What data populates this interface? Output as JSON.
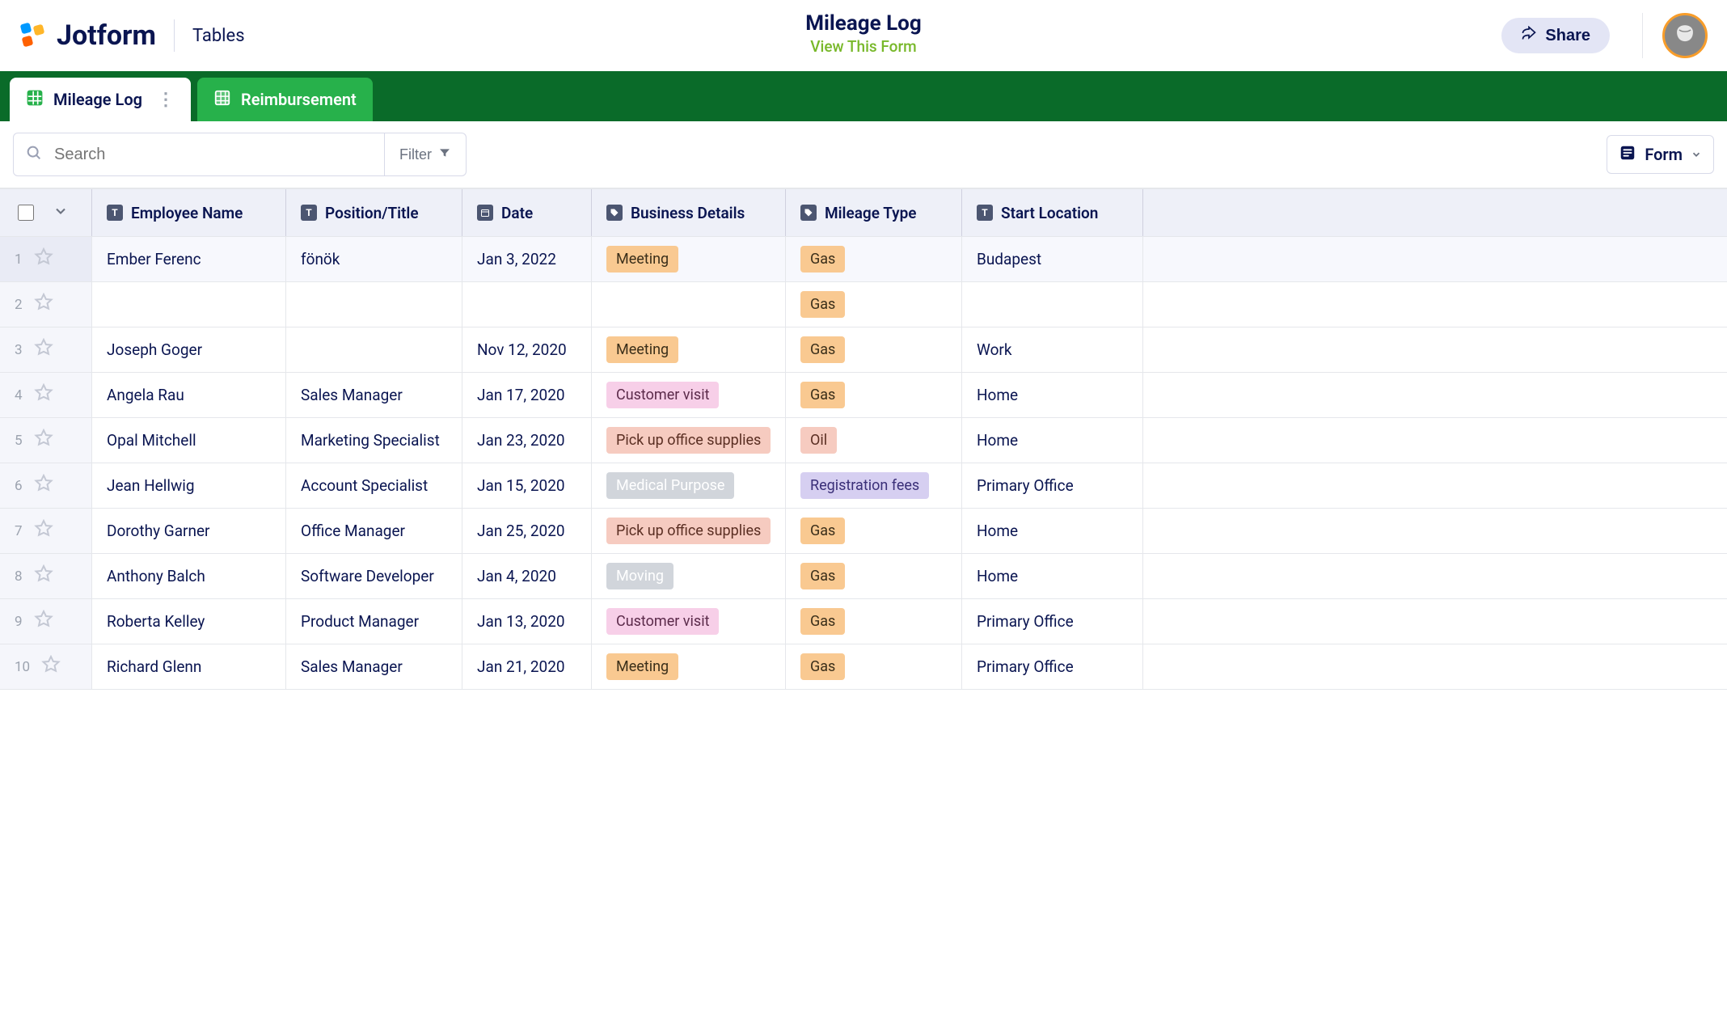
{
  "header": {
    "brand": "Jotform",
    "section": "Tables",
    "title": "Mileage Log",
    "subtitle": "View This Form",
    "share_label": "Share"
  },
  "tabs": [
    {
      "label": "Mileage Log",
      "active": true
    },
    {
      "label": "Reimbursement",
      "active": false
    }
  ],
  "toolbar": {
    "search_placeholder": "Search",
    "filter_label": "Filter",
    "view_label": "Form"
  },
  "columns": {
    "employee": "Employee Name",
    "position": "Position/Title",
    "date": "Date",
    "business": "Business Details",
    "mileage": "Mileage Type",
    "start": "Start Location"
  },
  "tag_colors": {
    "Meeting": "orange",
    "Customer visit": "pink",
    "Pick up office supplies": "peach",
    "Medical Purpose": "grey",
    "Moving": "grey",
    "Gas": "orange",
    "Oil": "peach",
    "Registration fees": "purple"
  },
  "rows": [
    {
      "n": 1,
      "employee": "Ember Ferenc",
      "position": "fönök",
      "date": "Jan 3, 2022",
      "business": "Meeting",
      "mileage": "Gas",
      "start": "Budapest"
    },
    {
      "n": 2,
      "employee": "",
      "position": "",
      "date": "",
      "business": "",
      "mileage": "Gas",
      "start": ""
    },
    {
      "n": 3,
      "employee": "Joseph Goger",
      "position": "",
      "date": "Nov 12, 2020",
      "business": "Meeting",
      "mileage": "Gas",
      "start": "Work"
    },
    {
      "n": 4,
      "employee": "Angela Rau",
      "position": "Sales Manager",
      "date": "Jan 17, 2020",
      "business": "Customer visit",
      "mileage": "Gas",
      "start": "Home"
    },
    {
      "n": 5,
      "employee": "Opal Mitchell",
      "position": "Marketing Specialist",
      "date": "Jan 23, 2020",
      "business": "Pick up office supplies",
      "mileage": "Oil",
      "start": "Home"
    },
    {
      "n": 6,
      "employee": "Jean Hellwig",
      "position": "Account Specialist",
      "date": "Jan 15, 2020",
      "business": "Medical Purpose",
      "mileage": "Registration fees",
      "start": "Primary Office"
    },
    {
      "n": 7,
      "employee": "Dorothy Garner",
      "position": "Office Manager",
      "date": "Jan 25, 2020",
      "business": "Pick up office supplies",
      "mileage": "Gas",
      "start": "Home"
    },
    {
      "n": 8,
      "employee": "Anthony Balch",
      "position": "Software Developer",
      "date": "Jan 4, 2020",
      "business": "Moving",
      "mileage": "Gas",
      "start": "Home"
    },
    {
      "n": 9,
      "employee": "Roberta Kelley",
      "position": "Product Manager",
      "date": "Jan 13, 2020",
      "business": "Customer visit",
      "mileage": "Gas",
      "start": "Primary Office"
    },
    {
      "n": 10,
      "employee": "Richard Glenn",
      "position": "Sales Manager",
      "date": "Jan 21, 2020",
      "business": "Meeting",
      "mileage": "Gas",
      "start": "Primary Office"
    }
  ]
}
